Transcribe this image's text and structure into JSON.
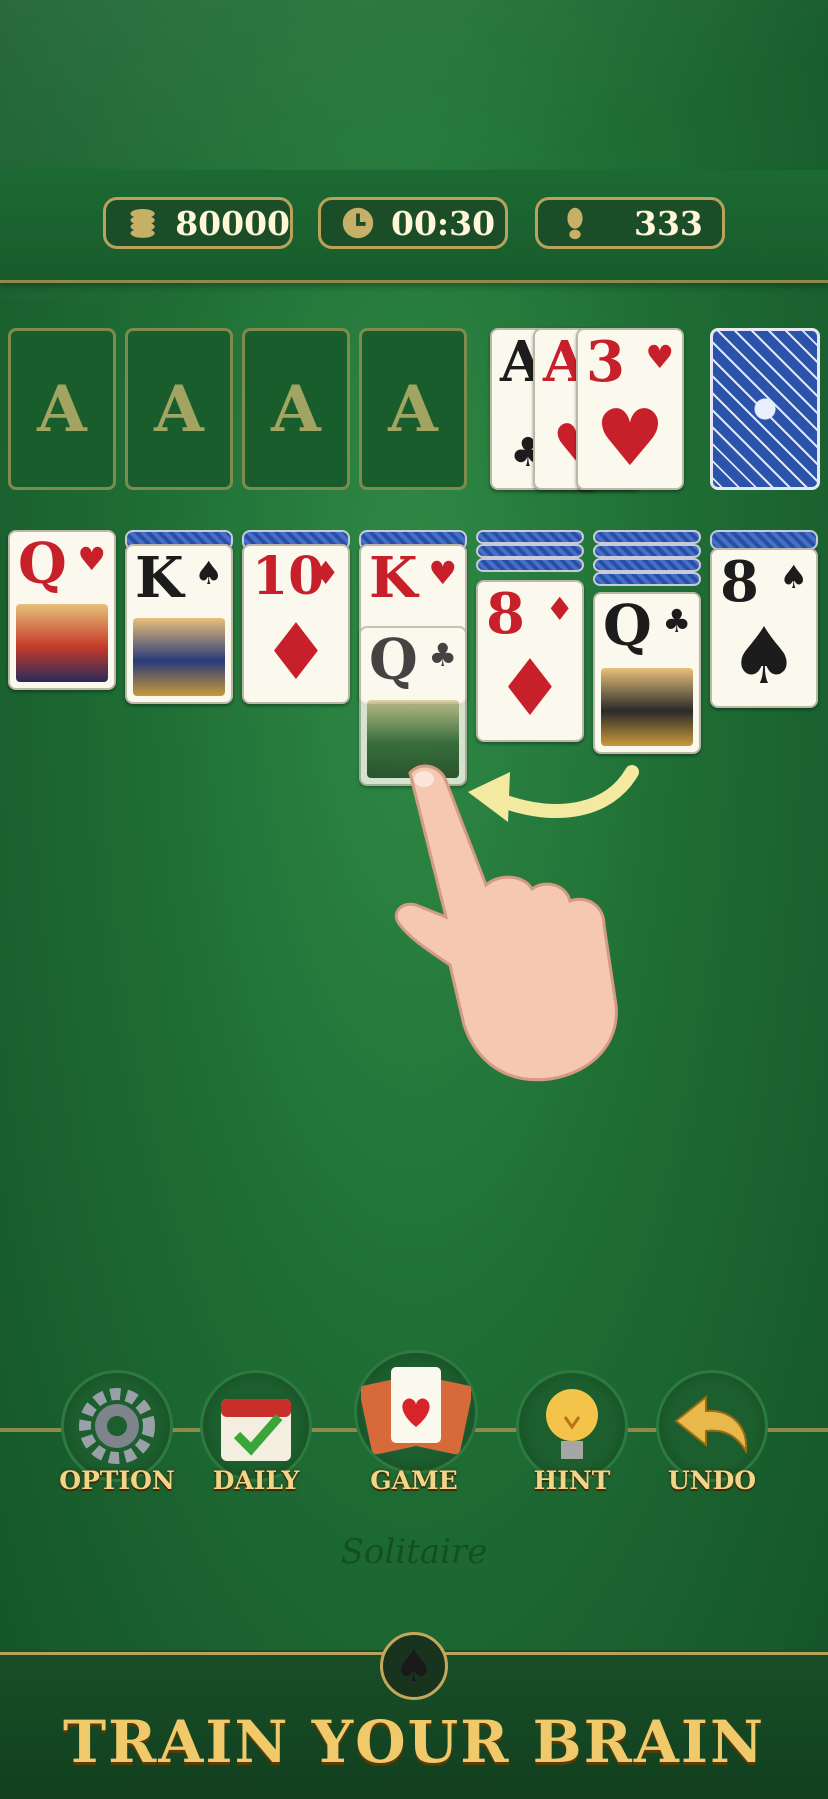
{
  "hud": {
    "coins": "80000",
    "timer": "00:30",
    "moves": "333"
  },
  "foundations": [
    "A",
    "A",
    "A",
    "A"
  ],
  "waste": [
    {
      "rank": "A",
      "suit": "♣",
      "color": "black"
    },
    {
      "rank": "A",
      "suit": "♥",
      "color": "red"
    },
    {
      "rank": "3",
      "suit": "♥",
      "color": "red"
    }
  ],
  "tableau": [
    {
      "rank": "Q",
      "suit": "♥",
      "color": "red"
    },
    {
      "rank": "K",
      "suit": "♠",
      "color": "black"
    },
    {
      "rank": "10",
      "suit": "♦",
      "color": "red"
    },
    {
      "rank": "K",
      "suit": "♥",
      "color": "red"
    },
    {
      "rank": "8",
      "suit": "♦",
      "color": "red"
    },
    {
      "rank": "Q",
      "suit": "♣",
      "color": "black"
    },
    {
      "rank": "8",
      "suit": "♠",
      "color": "black"
    }
  ],
  "dragging_card": {
    "rank": "Q",
    "suit": "♣",
    "color": "black"
  },
  "toolbar": {
    "option": "OPTION",
    "daily": "DAILY",
    "game": "GAME",
    "hint": "HINT",
    "undo": "UNDO"
  },
  "watermark": "Solitaire",
  "banner": {
    "title": "TRAIN YOUR BRAIN"
  },
  "colors": {
    "felt": "#1f6e35",
    "gold": "#f0c96a",
    "red_suit": "#c8202a",
    "card_back": "#2a4ea6"
  }
}
